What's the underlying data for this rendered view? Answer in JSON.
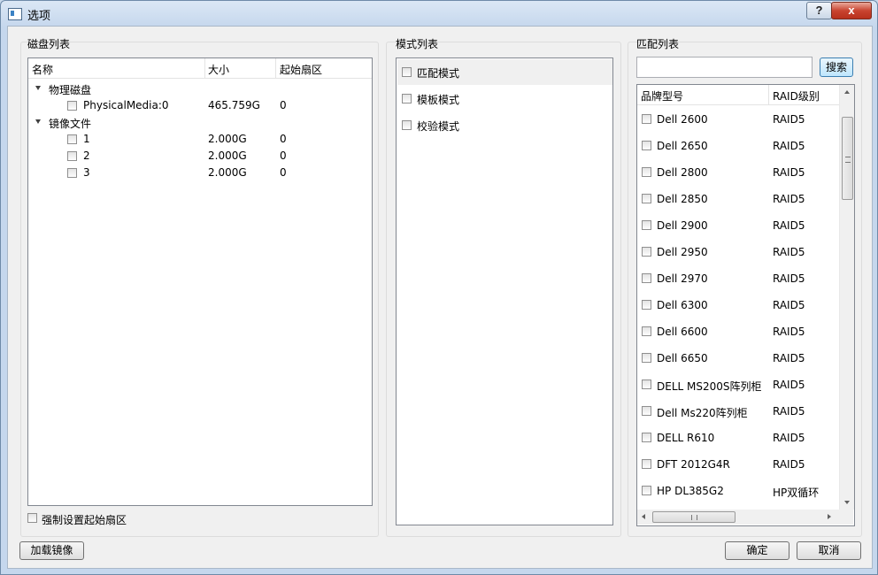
{
  "window": {
    "title": "选项",
    "help_label": "?",
    "close_label": "x"
  },
  "colors": {
    "title_gradient_top": "#dbe7f5",
    "client_bg": "#f0f0f0",
    "close_red": "#c94430",
    "focus_blue": "#3c7fb1"
  },
  "icons": {
    "title": "window-icon",
    "help": "question-mark-icon",
    "close": "close-icon"
  },
  "disk_list": {
    "group_title": "磁盘列表",
    "columns": [
      "名称",
      "大小",
      "起始扇区"
    ],
    "nodes": [
      {
        "label": "物理磁盘",
        "children": [
          {
            "name": "PhysicalMedia:0",
            "size": "465.759G",
            "start": "0"
          }
        ]
      },
      {
        "label": "镜像文件",
        "children": [
          {
            "name": "1",
            "size": "2.000G",
            "start": "0"
          },
          {
            "name": "2",
            "size": "2.000G",
            "start": "0"
          },
          {
            "name": "3",
            "size": "2.000G",
            "start": "0"
          }
        ]
      }
    ],
    "force_start_sector_label": "强制设置起始扇区"
  },
  "mode_list": {
    "group_title": "模式列表",
    "items": [
      "匹配模式",
      "模板模式",
      "校验模式"
    ]
  },
  "match_list": {
    "group_title": "匹配列表",
    "search_value": "",
    "search_button": "搜索",
    "columns": [
      "品牌型号",
      "RAID级别"
    ],
    "rows": [
      {
        "model": "Dell 2600",
        "raid": "RAID5"
      },
      {
        "model": "Dell 2650",
        "raid": "RAID5"
      },
      {
        "model": "Dell 2800",
        "raid": "RAID5"
      },
      {
        "model": "Dell 2850",
        "raid": "RAID5"
      },
      {
        "model": "Dell 2900",
        "raid": "RAID5"
      },
      {
        "model": "Dell 2950",
        "raid": "RAID5"
      },
      {
        "model": "Dell 2970",
        "raid": "RAID5"
      },
      {
        "model": "Dell 6300",
        "raid": "RAID5"
      },
      {
        "model": "Dell 6600",
        "raid": "RAID5"
      },
      {
        "model": "Dell 6650",
        "raid": "RAID5"
      },
      {
        "model": "DELL MS200S阵列柜",
        "raid": "RAID5"
      },
      {
        "model": "Dell Ms220阵列柜",
        "raid": "RAID5"
      },
      {
        "model": "DELL R610",
        "raid": "RAID5"
      },
      {
        "model": "DFT 2012G4R",
        "raid": "RAID5"
      },
      {
        "model": "HP DL385G2",
        "raid": "HP双循环"
      }
    ]
  },
  "footer": {
    "load_image": "加载镜像",
    "ok": "确定",
    "cancel": "取消"
  }
}
